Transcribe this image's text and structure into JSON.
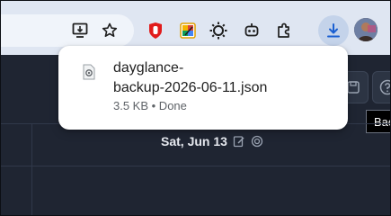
{
  "browser": {
    "toolbar_icons": [
      "install-app-icon",
      "bookmark-star-icon",
      "adblock-extension-icon",
      "color-picker-extension-icon",
      "sun-extension-icon",
      "robot-extension-icon",
      "extensions-puzzle-icon",
      "downloads-icon",
      "profile-avatar"
    ],
    "accent": "#1a73e8"
  },
  "download": {
    "file_name_line1": "dayglance-",
    "file_name_line2": "backup-2026-06-11.json",
    "status": "3.5 KB • Done"
  },
  "app": {
    "day_label": "Sat, Jun 13",
    "tooltip": "Back"
  }
}
